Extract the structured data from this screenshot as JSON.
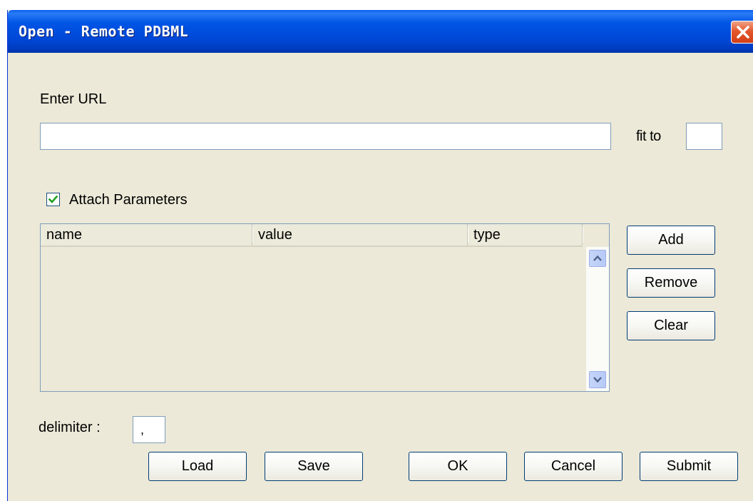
{
  "window": {
    "title": "Open - Remote PDBML"
  },
  "url_section": {
    "label": "Enter URL",
    "url_value": "",
    "fit_to_label": "fit to",
    "fit_to_value": ""
  },
  "parameters": {
    "attach_label": "Attach Parameters",
    "attach_checked": true,
    "columns": [
      "name",
      "value",
      "type"
    ],
    "rows": []
  },
  "side_buttons": {
    "add": "Add",
    "remove": "Remove",
    "clear": "Clear"
  },
  "delimiter": {
    "label": "delimiter :",
    "value": ","
  },
  "footer_buttons": {
    "load": "Load",
    "save": "Save",
    "ok": "OK",
    "cancel": "Cancel",
    "submit": "Submit"
  },
  "colors": {
    "titlebar": "#0055e5",
    "dialog_bg": "#ece9d8",
    "checkmark": "#21a121",
    "close_button": "#e3572c"
  },
  "icons": {
    "close": "close-icon",
    "checkmark": "checkmark-icon",
    "scroll_up": "chevron-up-icon",
    "scroll_down": "chevron-down-icon"
  }
}
